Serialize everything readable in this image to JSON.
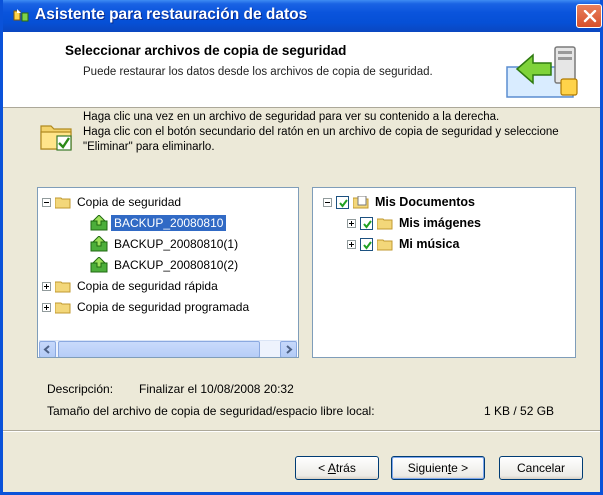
{
  "window": {
    "title": "Asistente para restauración de datos"
  },
  "header": {
    "title": "Seleccionar archivos de copia de seguridad",
    "subtitle": "Puede restaurar los datos desde los archivos de copia de seguridad."
  },
  "info": {
    "line1": "Haga clic una vez en un archivo de seguridad para ver su contenido a la derecha.",
    "line2": "Haga clic con el botón secundario del ratón en un archivo de copia de seguridad y seleccione \"Eliminar\" para eliminarlo."
  },
  "left_tree": {
    "items": [
      {
        "label": "Copia de seguridad",
        "type": "folder",
        "expanded": true
      },
      {
        "label": "BACKUP_20080810",
        "type": "backup",
        "selected": true
      },
      {
        "label": "BACKUP_20080810(1)",
        "type": "backup"
      },
      {
        "label": "BACKUP_20080810(2)",
        "type": "backup"
      },
      {
        "label": "Copia de seguridad rápida",
        "type": "folder",
        "expanded": false
      },
      {
        "label": "Copia de seguridad programada",
        "type": "folder",
        "expanded": false
      }
    ]
  },
  "right_tree": {
    "items": [
      {
        "label": "Mis Documentos",
        "checked": true,
        "expanded": true
      },
      {
        "label": "Mis imágenes",
        "checked": true,
        "expanded": false
      },
      {
        "label": "Mi música",
        "checked": true,
        "expanded": false
      }
    ]
  },
  "details": {
    "description_label": "Descripción:",
    "description_value": "Finalizar el 10/08/2008 20:32",
    "size_label": "Tamaño del archivo de copia de seguridad/espacio libre local:",
    "size_value": "1 KB / 52 GB"
  },
  "buttons": {
    "back_prefix": "< ",
    "back_mnemonic": "A",
    "back_rest": "trás",
    "next_prefix": "Siguien",
    "next_mnemonic": "t",
    "next_rest": "e >",
    "cancel": "Cancelar"
  },
  "colors": {
    "titlebar": "#0a54dc",
    "selection": "#316ac5",
    "dialog_bg": "#ece9d8"
  }
}
